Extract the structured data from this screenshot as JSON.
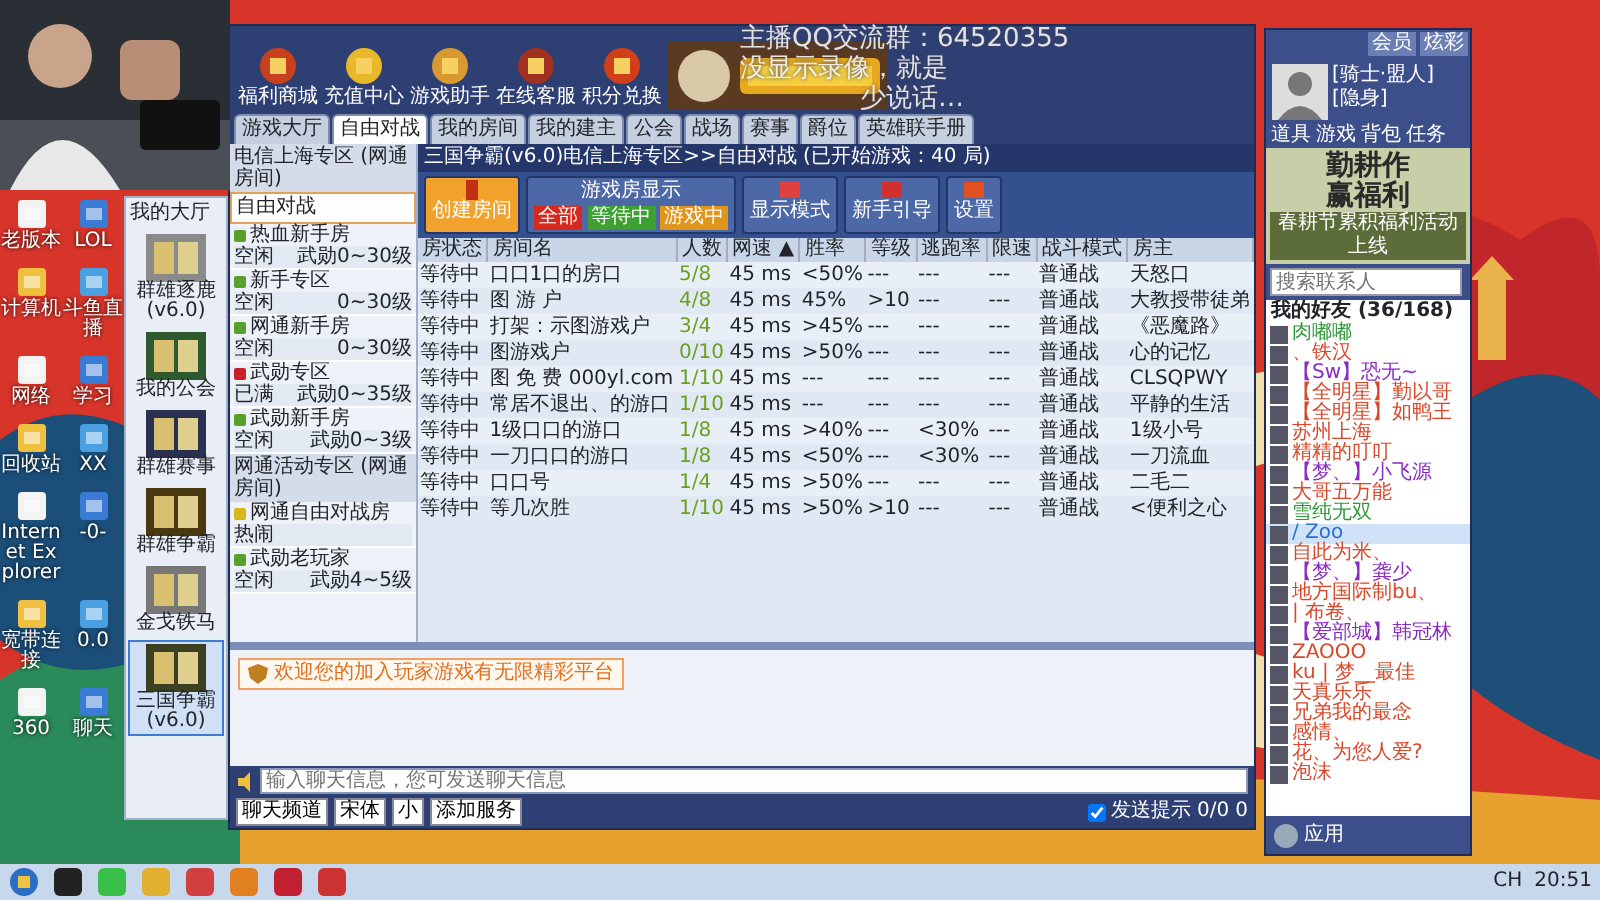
{
  "overlay": {
    "lines": [
      "主播QQ交流群：64520355",
      "没显示录像，就是",
      "少说话…"
    ]
  },
  "desktop_icons": [
    {
      "label": "老版本"
    },
    {
      "label": "LOL"
    },
    {
      "label": "计算机"
    },
    {
      "label": "斗鱼直播"
    },
    {
      "label": "网络"
    },
    {
      "label": "学习"
    },
    {
      "label": "回收站"
    },
    {
      "label": "XX"
    },
    {
      "label": "Internet Explorer"
    },
    {
      "label": "-0-"
    },
    {
      "label": "宽带连接"
    },
    {
      "label": "0.0"
    },
    {
      "label": "360"
    },
    {
      "label": "聊天"
    }
  ],
  "game_list": {
    "title": "我的大厅",
    "items": [
      {
        "label": "群雄逐鹿(v6.0)",
        "selected": false
      },
      {
        "label": "我的公会",
        "selected": false
      },
      {
        "label": "群雄赛事",
        "selected": false
      },
      {
        "label": "群雄争霸",
        "selected": false
      },
      {
        "label": "金戈铁马",
        "selected": false
      },
      {
        "label": "三国争霸(v6.0)",
        "selected": true
      }
    ]
  },
  "game_window": {
    "banner_buttons": [
      "福利商城",
      "充值中心",
      "游戏助手",
      "在线客服",
      "积分兑换"
    ],
    "tabs": [
      {
        "label": "游戏大厅",
        "selected": false
      },
      {
        "label": "自由对战",
        "selected": true
      },
      {
        "label": "我的房间",
        "selected": false
      },
      {
        "label": "我的建主",
        "selected": false
      },
      {
        "label": "公会",
        "selected": false
      },
      {
        "label": "战场",
        "selected": false
      },
      {
        "label": "赛事",
        "selected": false
      },
      {
        "label": "爵位",
        "selected": false
      },
      {
        "label": "英雄联手册",
        "selected": false
      }
    ],
    "breadcrumb": "三国争霸(v6.0)电信上海专区>>自由对战 (已开始游戏：40 局)",
    "rooms": [
      {
        "kind": "header",
        "name": "电信上海专区 (网通房间)"
      },
      {
        "kind": "current",
        "name": "自由对战"
      },
      {
        "kind": "room",
        "name": "热血新手房",
        "status": "空闲",
        "range": "武勋0~30级",
        "color": "#5aa02c"
      },
      {
        "kind": "room",
        "name": "新手专区",
        "status": "空闲",
        "range": "0~30级",
        "color": "#5aa02c"
      },
      {
        "kind": "room",
        "name": "网通新手房",
        "status": "空闲",
        "range": "0~30级",
        "color": "#5aa02c"
      },
      {
        "kind": "room",
        "name": "武勋专区",
        "status": "已满",
        "range": "武勋0~35级",
        "color": "#c8202a"
      },
      {
        "kind": "room",
        "name": "武勋新手房",
        "status": "空闲",
        "range": "武勋0~3级",
        "color": "#5aa02c"
      },
      {
        "kind": "header",
        "name": "网通活动专区 (网通房间)"
      },
      {
        "kind": "room",
        "name": "网通自由对战房",
        "status": "热闹",
        "color": "#d6b81c"
      },
      {
        "kind": "room",
        "name": "武勋老玩家",
        "status": "空闲",
        "range": "武勋4~5级",
        "color": "#5aa02c"
      }
    ],
    "create_button": "创建房间",
    "filter": {
      "title": "游戏房显示",
      "options": [
        {
          "label": "全部",
          "color": "#d42a1e"
        },
        {
          "label": "等待中",
          "color": "#3ea033"
        },
        {
          "label": "游戏中",
          "color": "#e0951c"
        }
      ]
    },
    "tool_buttons": [
      "显示模式",
      "新手引导",
      "设置"
    ],
    "table": {
      "columns": [
        "房状态",
        "房间名",
        "人数",
        "网速 ▲",
        "胜率",
        "等级",
        "逃跑率",
        "限速",
        "战斗模式",
        "房主"
      ],
      "rows": [
        [
          "等待中",
          "口口1口的房口",
          "5/8",
          "45 ms",
          "<50%",
          "---",
          "---",
          "---",
          "普通战",
          "天怒口"
        ],
        [
          "等待中",
          "图 游 户",
          "4/8",
          "45 ms",
          "45%",
          ">10",
          "---",
          "---",
          "普通战",
          "大教授带徒弟"
        ],
        [
          "等待中",
          "打架：示图游戏户",
          "3/4",
          "45 ms",
          ">45%",
          "---",
          "---",
          "---",
          "普通战",
          "《恶魔路》"
        ],
        [
          "等待中",
          "图游戏户",
          "0/10",
          "45 ms",
          ">50%",
          "---",
          "---",
          "---",
          "普通战",
          "心的记忆"
        ],
        [
          "等待中",
          "图 免 费 000yl.com",
          "1/10",
          "45 ms",
          "---",
          "---",
          "---",
          "---",
          "普通战",
          "CLSQPWY"
        ],
        [
          "等待中",
          "常居不退出、的游口",
          "1/10",
          "45 ms",
          "---",
          "---",
          "---",
          "---",
          "普通战",
          "平静的生活"
        ],
        [
          "等待中",
          "1级口口的游口",
          "1/8",
          "45 ms",
          ">40%",
          "---",
          "<30%",
          "---",
          "普通战",
          "1级小号"
        ],
        [
          "等待中",
          "一刀口口的游口",
          "1/8",
          "45 ms",
          "<50%",
          "---",
          "<30%",
          "---",
          "普通战",
          "一刀流血"
        ],
        [
          "等待中",
          "口口号",
          "1/4",
          "45 ms",
          ">50%",
          "---",
          "---",
          "---",
          "普通战",
          "二毛二"
        ],
        [
          "等待中",
          "等几次胜",
          "1/10",
          "45 ms",
          ">50%",
          ">10",
          "---",
          "---",
          "普通战",
          "<便利之心"
        ]
      ]
    },
    "notice": "欢迎您的加入玩家游戏有无限精彩平台",
    "chat_input": {
      "placeholder": "输入聊天信息，您可发送聊天信息"
    },
    "chat_controls": [
      "聊天频道",
      "宋体",
      "小",
      "添加服务"
    ],
    "send_tip": {
      "label": "发送提示",
      "checked": true
    },
    "counters": [
      "0/0",
      "0"
    ]
  },
  "qq": {
    "title_buttons": [
      "会员",
      "炫彩"
    ],
    "nickname": "[骑士·盟人]",
    "status": "[隐身]",
    "apps": [
      "道具",
      "游戏",
      "背包",
      "任务"
    ],
    "ad": {
      "title": "勤耕作",
      "subtitle": "赢福利",
      "caption": "春耕节累积福利活动上线"
    },
    "search": {
      "placeholder": "搜索联系人"
    },
    "group": "我的好友 (36/168)",
    "friends": [
      {
        "name": "肉嘟嘟",
        "color": "#2f9a3a",
        "selected": false
      },
      {
        "name": "、铁汉",
        "color": "#d9482b",
        "selected": false
      },
      {
        "name": "【Sw】恐无~",
        "color": "#8a2bc4",
        "selected": false
      },
      {
        "name": "【全明星】勤以哥",
        "color": "#d9482b",
        "selected": false
      },
      {
        "name": "【全明星】如鸭王",
        "color": "#d9482b",
        "selected": false
      },
      {
        "name": "苏州上海",
        "color": "#d9482b",
        "selected": false
      },
      {
        "name": "精精的叮叮",
        "color": "#d9482b",
        "selected": false
      },
      {
        "name": "【梦、】小飞源",
        "color": "#8a2bc4",
        "selected": false
      },
      {
        "name": "大哥五万能",
        "color": "#d9482b",
        "selected": false
      },
      {
        "name": "雪纯无双",
        "color": "#2f9a3a",
        "selected": false
      },
      {
        "name": "/ Zoo",
        "color": "#2a6fd0",
        "selected": true
      },
      {
        "name": "自此为米、",
        "color": "#d9482b",
        "selected": false
      },
      {
        "name": "【梦、】龚少",
        "color": "#8a2bc4",
        "selected": false
      },
      {
        "name": "地方国际制bu、",
        "color": "#d9482b",
        "selected": false
      },
      {
        "name": "| 布卷、",
        "color": "#d9482b",
        "selected": false
      },
      {
        "name": "【爱部城】韩冠林",
        "color": "#8a2bc4",
        "selected": false
      },
      {
        "name": "ZAOOO",
        "color": "#d9482b",
        "selected": false
      },
      {
        "name": "ku | 梦__最佳",
        "color": "#d9482b",
        "selected": false
      },
      {
        "name": "天真乐乐",
        "color": "#d9482b",
        "selected": false
      },
      {
        "name": "兄弟我的最念",
        "color": "#d9482b",
        "selected": false
      },
      {
        "name": "感情、",
        "color": "#d9482b",
        "selected": false
      },
      {
        "name": "花、为您人爱?",
        "color": "#d9482b",
        "selected": false
      },
      {
        "name": "泡沫",
        "color": "#d9482b",
        "selected": false
      }
    ],
    "bottom_label": "应用"
  },
  "taskbar": {
    "tray": "CH",
    "time": "20:51"
  }
}
